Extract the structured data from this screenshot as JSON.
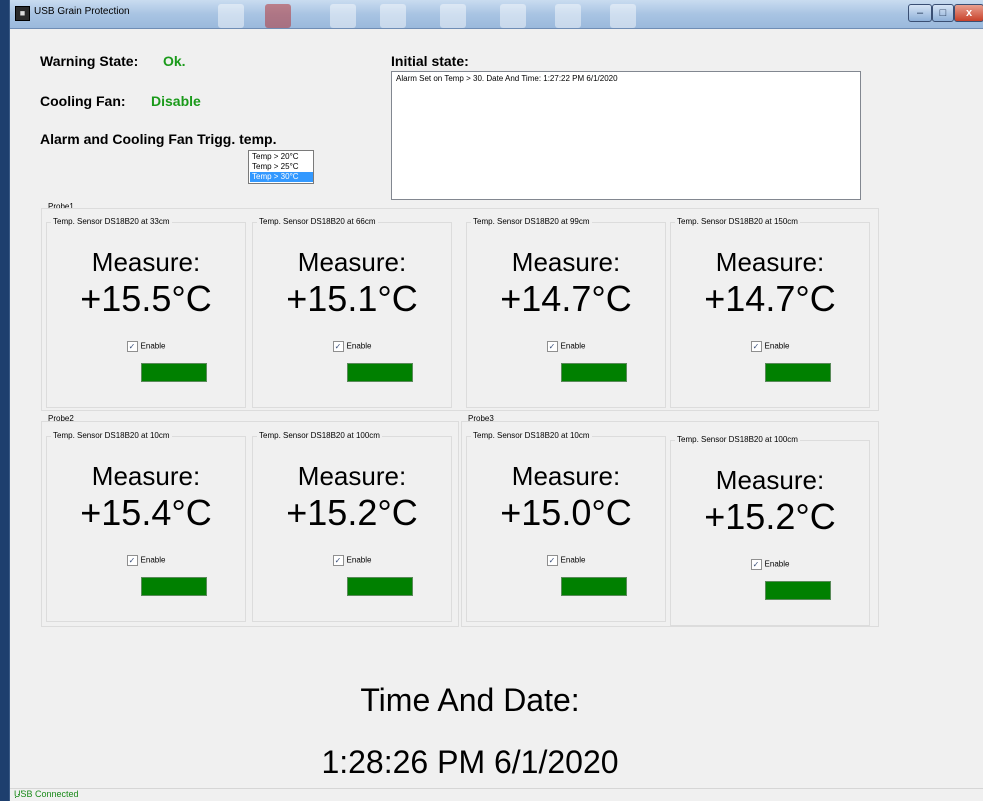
{
  "window": {
    "title": "USB Grain Protection",
    "min": "–",
    "max": "□",
    "close": "x"
  },
  "warning": {
    "label": "Warning State:",
    "value": "Ok."
  },
  "cooling_fan": {
    "label": "Cooling Fan:",
    "value": "Disable"
  },
  "trigger": {
    "label": "Alarm and Cooling Fan Trigg. temp.",
    "options": [
      "Temp > 20°C",
      "Temp > 25°C",
      "Temp > 30°C"
    ],
    "selected": "Temp > 30°C"
  },
  "initial_state": {
    "label": "Initial state:",
    "log": "Alarm Set on Temp > 30. Date And Time: 1:27:22 PM  6/1/2020"
  },
  "probes": [
    {
      "name": "Probe1",
      "sensors": [
        {
          "title": "Temp. Sensor DS18B20 at 33cm",
          "measure_label": "Measure:",
          "temp": "+15.5°C",
          "enable_label": "Enable",
          "enabled": true,
          "status_color": "#008000"
        },
        {
          "title": "Temp. Sensor DS18B20 at 66cm",
          "measure_label": "Measure:",
          "temp": "+15.1°C",
          "enable_label": "Enable",
          "enabled": true,
          "status_color": "#008000"
        },
        {
          "title": "Temp. Sensor DS18B20 at 99cm",
          "measure_label": "Measure:",
          "temp": "+14.7°C",
          "enable_label": "Enable",
          "enabled": true,
          "status_color": "#008000"
        },
        {
          "title": "Temp. Sensor DS18B20 at 150cm",
          "measure_label": "Measure:",
          "temp": "+14.7°C",
          "enable_label": "Enable",
          "enabled": true,
          "status_color": "#008000"
        }
      ]
    },
    {
      "name": "Probe2",
      "sensors": [
        {
          "title": "Temp. Sensor DS18B20 at 10cm",
          "measure_label": "Measure:",
          "temp": "+15.4°C",
          "enable_label": "Enable",
          "enabled": true,
          "status_color": "#008000"
        },
        {
          "title": "Temp. Sensor DS18B20 at 100cm",
          "measure_label": "Measure:",
          "temp": "+15.2°C",
          "enable_label": "Enable",
          "enabled": true,
          "status_color": "#008000"
        }
      ]
    },
    {
      "name": "Probe3",
      "sensors": [
        {
          "title": "Temp. Sensor DS18B20 at 10cm",
          "measure_label": "Measure:",
          "temp": "+15.0°C",
          "enable_label": "Enable",
          "enabled": true,
          "status_color": "#008000"
        },
        {
          "title": "Temp. Sensor DS18B20 at 100cm",
          "measure_label": "Measure:",
          "temp": "+15.2°C",
          "enable_label": "Enable",
          "enabled": true,
          "status_color": "#008000"
        }
      ]
    }
  ],
  "time": {
    "label": "Time And Date:",
    "value": "1:28:26 PM  6/1/2020"
  },
  "status_bar": {
    "text": "USB Connected"
  },
  "colors": {
    "ok_green": "#1a9a1a",
    "selection_blue": "#3399ff"
  }
}
